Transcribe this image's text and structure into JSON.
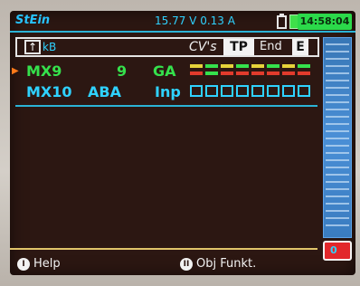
{
  "status": {
    "title": "StEin",
    "voltage": "15.77 V  0.13 A",
    "clock": "14:58:04"
  },
  "toolbar": {
    "arrow": "↑",
    "kb_label": "kB",
    "cvs_label": "CV's",
    "tp_label": "TP",
    "end_label": "End",
    "e_label": "E"
  },
  "rows": [
    {
      "loco": "MX9",
      "address": "9",
      "mode": "GA",
      "type": "outputs"
    },
    {
      "loco": "MX10",
      "address": "ABA",
      "mode": "Inp",
      "type": "inputs"
    }
  ],
  "outputs": [
    {
      "top": "#e6d23a",
      "bottom": "#e23b2c"
    },
    {
      "top": "#35e14c",
      "bottom": "#35e14c"
    },
    {
      "top": "#e6d23a",
      "bottom": "#e23b2c"
    },
    {
      "top": "#35e14c",
      "bottom": "#e23b2c"
    },
    {
      "top": "#e6d23a",
      "bottom": "#e23b2c"
    },
    {
      "top": "#35e14c",
      "bottom": "#e23b2c"
    },
    {
      "top": "#e6d23a",
      "bottom": "#e23b2c"
    },
    {
      "top": "#35e14c",
      "bottom": "#e23b2c"
    }
  ],
  "inputs_count": 8,
  "speed": {
    "value": "0"
  },
  "softkeys": {
    "help_badge": "I",
    "help_label": "Help",
    "obj_badge": "II",
    "obj_label": "Obj Funkt."
  },
  "colors": {
    "accent": "#2bb3d6",
    "green": "#35e14c",
    "cyan": "#2fd2ff",
    "screen_bg": "#2c1712"
  }
}
